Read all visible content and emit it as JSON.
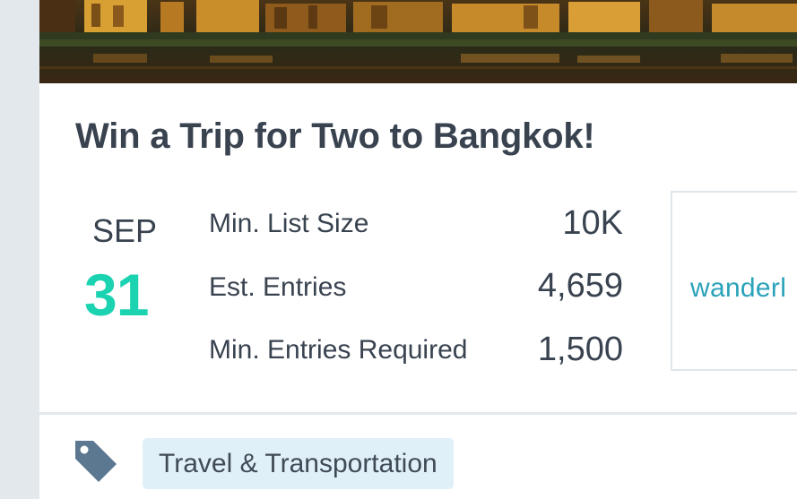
{
  "card": {
    "title": "Win a Trip for Two to Bangkok!",
    "date": {
      "month": "SEP",
      "day": "31"
    },
    "stats": [
      {
        "label": "Min. List Size",
        "value": "10K"
      },
      {
        "label": "Est. Entries",
        "value": "4,659"
      },
      {
        "label": "Min. Entries Required",
        "value": "1,500"
      }
    ],
    "sponsor": {
      "logo_text": "wanderl"
    },
    "tags": [
      {
        "label": "Travel & Transportation"
      }
    ]
  },
  "colors": {
    "accent": "#1cd3b1",
    "text": "#394350",
    "tag_background": "#e0f0f8",
    "tag_icon": "#5b7890",
    "sponsor_logo": "#2aa2b9"
  },
  "icons": {
    "tag": "tag-icon"
  }
}
